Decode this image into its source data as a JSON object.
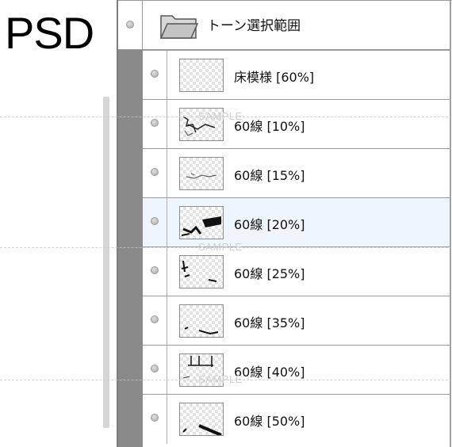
{
  "corner_label": "PSD",
  "layer_panel": {
    "group": {
      "name": "トーン選択範囲",
      "icon": "folder-icon"
    },
    "layers": [
      {
        "name": "床模様 [60%]"
      },
      {
        "name": "60線 [10%]"
      },
      {
        "name": "60線 [15%]"
      },
      {
        "name": "60線 [20%]",
        "selected": true
      },
      {
        "name": "60線 [25%]"
      },
      {
        "name": "60線 [35%]"
      },
      {
        "name": "60線 [40%]"
      },
      {
        "name": "60線 [50%]"
      }
    ]
  },
  "watermark_text": "SAMPLE",
  "colors": {
    "group_bar": "#8a8a8a",
    "selected_row": "#eef5fc",
    "border": "#9a9a9a"
  }
}
